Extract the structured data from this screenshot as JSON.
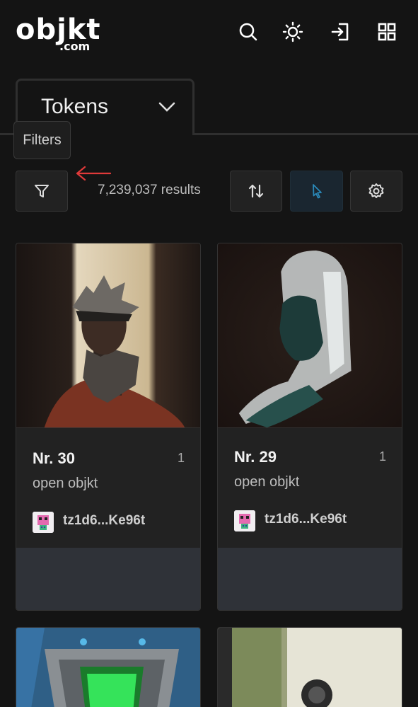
{
  "header": {
    "logo_main": "objkt",
    "logo_sub": ".com",
    "icons": [
      "search-icon",
      "theme-toggle-icon",
      "login-icon",
      "apps-grid-icon"
    ]
  },
  "tab": {
    "label": "Tokens"
  },
  "tooltip": {
    "text": "Filters"
  },
  "toolbar": {
    "results": "7,239,037 results",
    "accent_color": "#2a88b8"
  },
  "cards": [
    {
      "title": "Nr. 30",
      "editions": "1",
      "type": "open objkt",
      "creator": "tz1d6...Ke96t"
    },
    {
      "title": "Nr. 29",
      "editions": "1",
      "type": "open objkt",
      "creator": "tz1d6...Ke96t"
    }
  ]
}
